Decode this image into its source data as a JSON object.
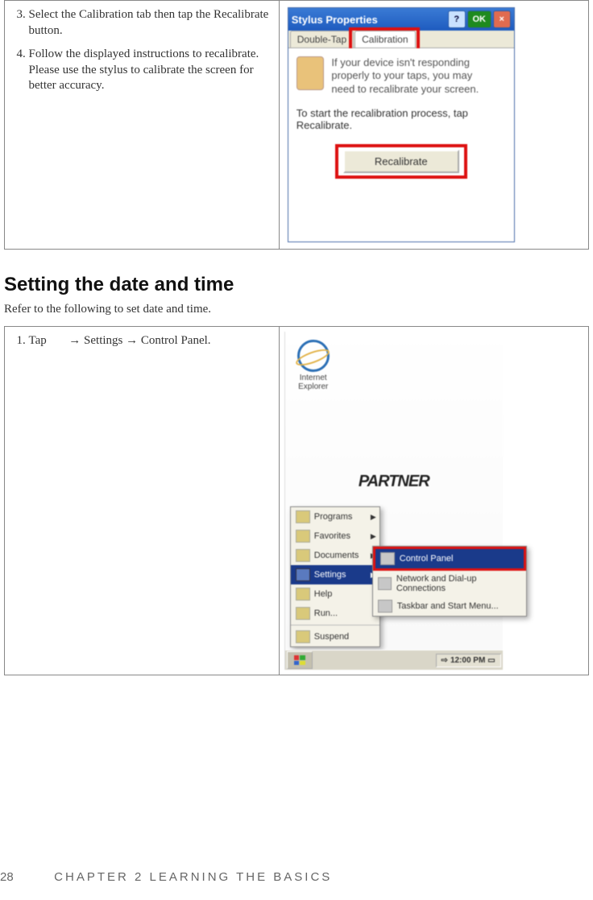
{
  "section1": {
    "steps": {
      "s3": "Select the Calibration tab then tap the Recalibrate button.",
      "s4": "Follow the displayed instructions to recalibrate. Please use the stylus to calibrate the screen for better accuracy."
    },
    "dialog": {
      "title": "Stylus Properties",
      "help": "?",
      "ok": "OK",
      "close": "×",
      "tab1": "Double-Tap",
      "tab2": "Calibration",
      "body1": "If your device isn't responding properly to your taps, you may need to recalibrate your screen.",
      "body2": "To start the recalibration process, tap Recalibrate.",
      "button": "Recalibrate"
    }
  },
  "section2": {
    "heading": "Setting the date and time",
    "intro": "Refer to the following to set date and time.",
    "step1_pre": "Tap ",
    "step1_post": " → Settings → Control Panel.",
    "desktop": {
      "ie": "Internet Explorer",
      "brand": "PARTNER",
      "menu": {
        "programs": "Programs",
        "favorites": "Favorites",
        "documents": "Documents",
        "settings": "Settings",
        "help": "Help",
        "run": "Run...",
        "suspend": "Suspend"
      },
      "submenu": {
        "controlPanel": "Control Panel",
        "network": "Network and Dial-up Connections",
        "taskbar": "Taskbar and Start Menu..."
      },
      "clock": "12:00 PM"
    }
  },
  "footer": {
    "page": "28",
    "chapter": "CHAPTER 2 LEARNING THE BASICS"
  }
}
